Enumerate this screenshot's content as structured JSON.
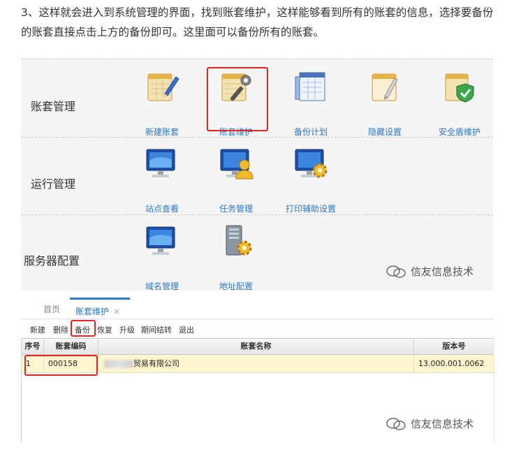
{
  "intro_text": "3、这样就会进入到系统管理的界面，找到账套维护，这样能够看到所有的账套的信息，选择要备份的账套直接点击上方的备份即可。这里面可以备份所有的账套。",
  "groups": {
    "account": {
      "label": "账套管理",
      "items": [
        {
          "label": "新建账套",
          "icon": "new-account-icon"
        },
        {
          "label": "账套维护",
          "icon": "account-maintenance-icon"
        },
        {
          "label": "备份计划",
          "icon": "backup-plan-icon"
        },
        {
          "label": "隐藏设置",
          "icon": "hidden-settings-icon"
        },
        {
          "label": "安全盾维护",
          "icon": "security-shield-icon"
        }
      ]
    },
    "run": {
      "label": "运行管理",
      "items": [
        {
          "label": "站点查看",
          "icon": "monitor-icon"
        },
        {
          "label": "任务管理",
          "icon": "user-monitor-icon"
        },
        {
          "label": "打印辅助设置",
          "icon": "gear-monitor-icon"
        }
      ]
    },
    "server": {
      "label": "服务器配置",
      "items": [
        {
          "label": "域名管理",
          "icon": "monitor-icon"
        },
        {
          "label": "地址配置",
          "icon": "server-gear-icon"
        }
      ]
    }
  },
  "watermark": "信友信息技术",
  "tabs": {
    "home": "首页",
    "active": "账套维护",
    "close": "×"
  },
  "toolbar": [
    "新建",
    "删除",
    "备份",
    "恢复",
    "升级",
    "期间结转",
    "退出"
  ],
  "table": {
    "headers": [
      "序号",
      "账套编码",
      "账套名称",
      "版本号"
    ],
    "rows": [
      {
        "index": "1",
        "code": "000158",
        "name": "贸易有限公司",
        "version": "13.000.001.0062"
      }
    ]
  },
  "colors": {
    "highlight": "#e0261f",
    "accent": "#2b78c5",
    "row_selected": "#fff6cf"
  }
}
